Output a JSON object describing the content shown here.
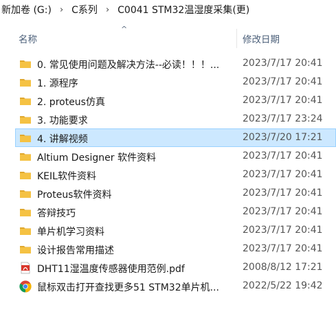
{
  "breadcrumb": {
    "items": [
      "新加卷 (G:)",
      "C系列",
      "C0041 STM32温湿度采集(更)"
    ],
    "separator": "›"
  },
  "columns": {
    "name": "名称",
    "sort_arrow": "^",
    "date": "修改日期"
  },
  "files": [
    {
      "name": "0. 常见使用问题及解决方法--必读！！！...",
      "date": "2023/7/17 20:41",
      "icon": "folder-icon",
      "selected": false
    },
    {
      "name": "1. 源程序",
      "date": "2023/7/17 20:41",
      "icon": "folder-icon",
      "selected": false
    },
    {
      "name": "2. proteus仿真",
      "date": "2023/7/17 20:41",
      "icon": "folder-icon",
      "selected": false
    },
    {
      "name": "3. 功能要求",
      "date": "2023/7/17 23:24",
      "icon": "folder-icon",
      "selected": false
    },
    {
      "name": "4. 讲解视频",
      "date": "2023/7/20 17:21",
      "icon": "folder-icon",
      "selected": true
    },
    {
      "name": "Altium Designer 软件资料",
      "date": "2023/7/17 20:41",
      "icon": "folder-icon",
      "selected": false
    },
    {
      "name": "KEIL软件资料",
      "date": "2023/7/17 20:41",
      "icon": "folder-icon",
      "selected": false
    },
    {
      "name": "Proteus软件资料",
      "date": "2023/7/17 20:41",
      "icon": "folder-icon",
      "selected": false
    },
    {
      "name": "答辩技巧",
      "date": "2023/7/17 20:41",
      "icon": "folder-icon",
      "selected": false
    },
    {
      "name": "单片机学习资料",
      "date": "2023/7/17 20:41",
      "icon": "folder-icon",
      "selected": false
    },
    {
      "name": "设计报告常用描述",
      "date": "2023/7/17 20:41",
      "icon": "folder-icon",
      "selected": false
    },
    {
      "name": "DHT11湿温度传感器使用范例.pdf",
      "date": "2008/8/12 17:21",
      "icon": "pdf-icon",
      "selected": false
    },
    {
      "name": "鼠标双击打开查找更多51 STM32单片机...",
      "date": "2022/5/22 19:42",
      "icon": "chrome-icon",
      "selected": false
    }
  ],
  "colors": {
    "folder": "#f5c243",
    "folder_dark": "#e0a82e",
    "selection_bg": "#cce8ff",
    "selection_border": "#99d1ff",
    "pdf": "#d9362b"
  }
}
